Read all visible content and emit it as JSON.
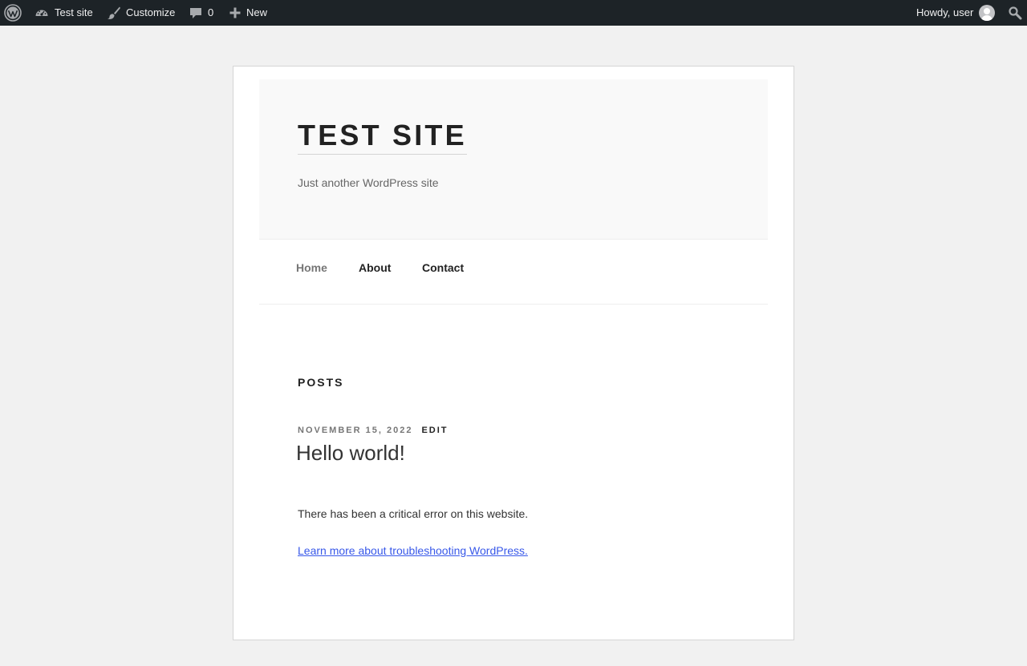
{
  "admin_bar": {
    "site_name": "Test site",
    "customize": "Customize",
    "comments_count": "0",
    "new_label": "New",
    "howdy": "Howdy, user"
  },
  "site": {
    "title": "TEST SITE",
    "tagline": "Just another WordPress site"
  },
  "nav": {
    "items": [
      {
        "label": "Home",
        "current": true
      },
      {
        "label": "About",
        "current": false
      },
      {
        "label": "Contact",
        "current": false
      }
    ]
  },
  "content": {
    "section_title": "POSTS",
    "post": {
      "date": "NOVEMBER 15, 2022",
      "edit_label": "EDIT",
      "title": "Hello world!",
      "body": "There has been a critical error on this website.",
      "link": "Learn more about troubleshooting WordPress."
    }
  },
  "colors": {
    "admin_bar_bg": "#1d2327",
    "link": "#3858e9",
    "page_bg": "#f1f1f1"
  }
}
